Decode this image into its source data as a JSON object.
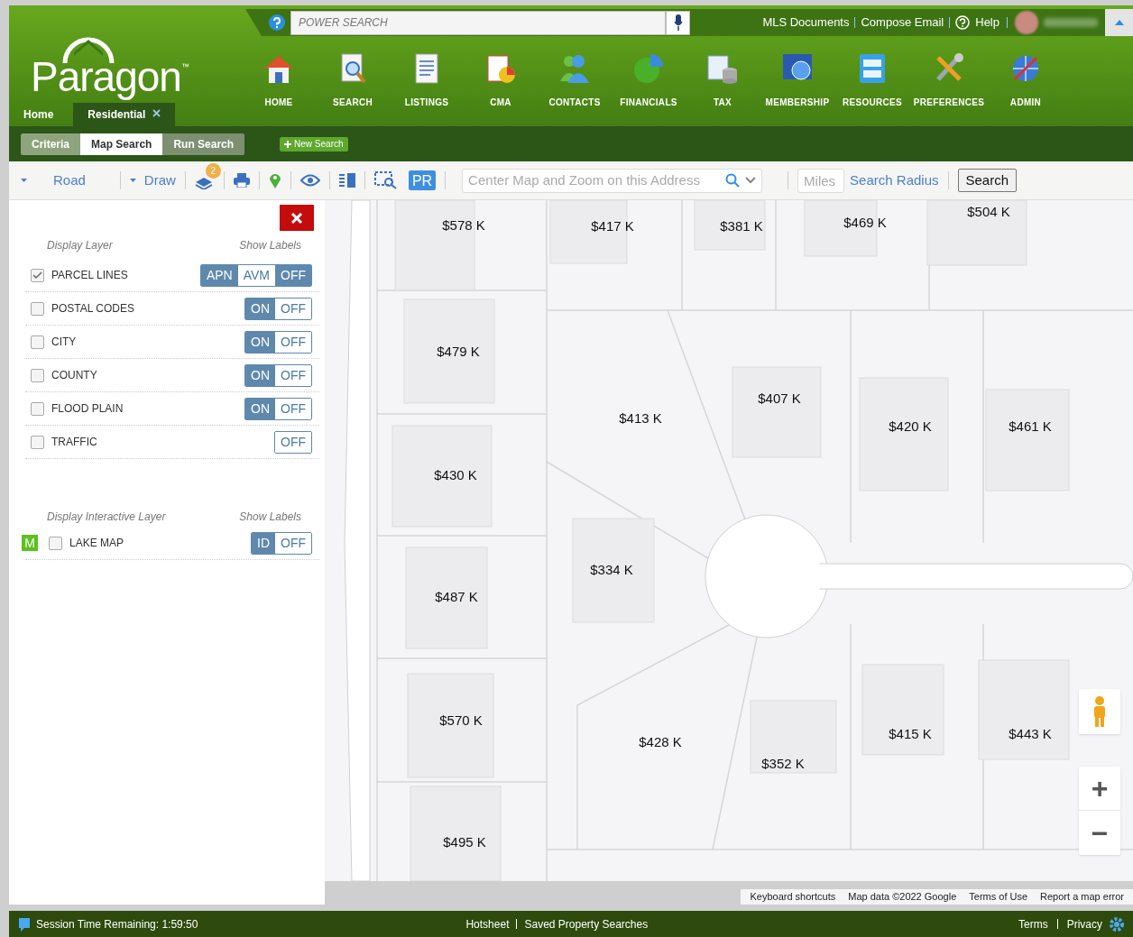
{
  "top_bar": {
    "search_placeholder": "POWER SEARCH",
    "links": [
      "MLS Documents",
      "Compose Email",
      "Help"
    ]
  },
  "logo": {
    "text": "Paragon",
    "mark": "™"
  },
  "nav": [
    {
      "label": "HOME"
    },
    {
      "label": "SEARCH"
    },
    {
      "label": "LISTINGS"
    },
    {
      "label": "CMA"
    },
    {
      "label": "CONTACTS"
    },
    {
      "label": "FINANCIALS"
    },
    {
      "label": "TAX"
    },
    {
      "label": "MEMBERSHIP"
    },
    {
      "label": "RESOURCES"
    },
    {
      "label": "PREFERENCES"
    },
    {
      "label": "ADMIN"
    }
  ],
  "tabs": [
    {
      "label": "Home",
      "selected": false,
      "closable": false
    },
    {
      "label": "Residential",
      "selected": true,
      "closable": true
    }
  ],
  "subtabs": [
    {
      "label": "Criteria",
      "selected": false
    },
    {
      "label": "Map Search",
      "selected": true
    },
    {
      "label": "Run Search",
      "selected": false
    }
  ],
  "new_search": "New Search",
  "toolbar": {
    "map_type": "Road",
    "draw": "Draw",
    "layers_badge": "2",
    "pr": "PR",
    "address_placeholder": "Center Map and Zoom on this Address",
    "miles_placeholder": "Miles",
    "radius_link": "Search Radius",
    "search_button": "Search"
  },
  "layer_panel": {
    "header": "Display Layer",
    "labels_header": "Show Labels",
    "layers": [
      {
        "name": "PARCEL LINES",
        "checked": true,
        "options": [
          {
            "label": "APN",
            "selected": false
          },
          {
            "label": "AVM",
            "selected": true
          },
          {
            "label": "OFF",
            "selected": false
          }
        ]
      },
      {
        "name": "POSTAL CODES",
        "checked": false,
        "options": [
          {
            "label": "ON",
            "selected": false
          },
          {
            "label": "OFF",
            "selected": true
          }
        ]
      },
      {
        "name": "CITY",
        "checked": false,
        "options": [
          {
            "label": "ON",
            "selected": false
          },
          {
            "label": "OFF",
            "selected": true
          }
        ]
      },
      {
        "name": "COUNTY",
        "checked": false,
        "options": [
          {
            "label": "ON",
            "selected": false
          },
          {
            "label": "OFF",
            "selected": true
          }
        ]
      },
      {
        "name": "FLOOD PLAIN",
        "checked": false,
        "options": [
          {
            "label": "ON",
            "selected": false
          },
          {
            "label": "OFF",
            "selected": true
          }
        ]
      },
      {
        "name": "TRAFFIC",
        "checked": false,
        "options": [
          {
            "label": "OFF",
            "selected": true
          }
        ]
      }
    ],
    "interactive_header": "Display Interactive Layer",
    "interactive_labels_header": "Show Labels",
    "interactive_layers": [
      {
        "badge": "M",
        "name": "LAKE MAP",
        "checked": false,
        "options": [
          {
            "label": "ID",
            "selected": false
          },
          {
            "label": "OFF",
            "selected": true
          }
        ]
      }
    ]
  },
  "map": {
    "prices": [
      "$578 K",
      "$417 K",
      "$381 K",
      "$469 K",
      "$504 K",
      "$479 K",
      "$407 K",
      "$413 K",
      "$420 K",
      "$461 K",
      "$430 K",
      "$334 K",
      "$487 K",
      "$570 K",
      "$428 K",
      "$415 K",
      "$443 K",
      "$352 K",
      "$495 K"
    ],
    "attribution": [
      "Keyboard shortcuts",
      "Map data ©2022 Google",
      "Terms of Use",
      "Report a map error"
    ],
    "zoom_in": "+",
    "zoom_out": "−"
  },
  "status_bar": {
    "session": "Session Time Remaining: 1:59:50",
    "center_links": [
      "Hotsheet",
      "Saved Property Searches"
    ],
    "right_links": [
      "Terms",
      "Privacy"
    ]
  }
}
